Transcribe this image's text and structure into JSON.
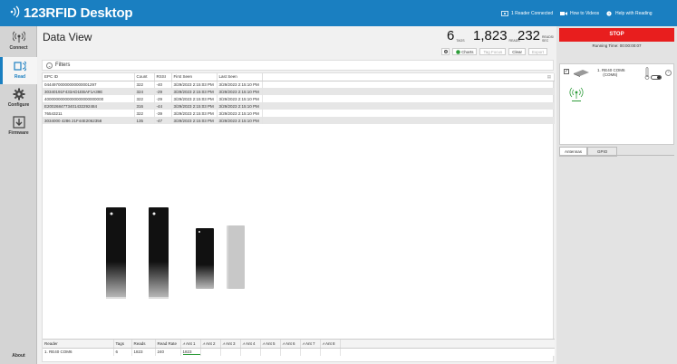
{
  "app": {
    "title": "123RFID Desktop",
    "header_items": {
      "reader_connected": "1 Reader Connected",
      "how_to_videos": "How to Videos",
      "help": "Help with Reading"
    }
  },
  "nav": {
    "items": [
      {
        "label": "Connect",
        "icon": "antenna-icon"
      },
      {
        "label": "Read",
        "icon": "rfid-read-icon",
        "active": true
      },
      {
        "label": "Configure",
        "icon": "gear-icon"
      },
      {
        "label": "Firmware",
        "icon": "download-icon"
      }
    ],
    "about": "About"
  },
  "main": {
    "title": "Data View",
    "stats": {
      "tags_value": "6",
      "tags_label": "TAGS",
      "reads_value": "1,823",
      "reads_label": "READS",
      "rate_value": "232",
      "rate_label_1": "READS/",
      "rate_label_2": "SEC"
    },
    "toolbar": {
      "charts": "Charts",
      "tag_focus": "Tag Focus",
      "clear": "Clear",
      "export": "Export"
    },
    "filters_label": "Filters",
    "columns": [
      "EPC ID",
      "Count",
      "RSSI",
      "First Seen",
      "Last Seen"
    ],
    "rows": [
      [
        "04449700000000000001297",
        "322",
        "-40",
        "3/29/2023 2:15:03 PM",
        "3/29/2023 2:15:10 PM"
      ],
      [
        "30340191F433AD1EBAF1A39E",
        "324",
        "-29",
        "3/29/2023 2:15:03 PM",
        "3/29/2023 2:15:10 PM"
      ],
      [
        "40000000000000000000000000",
        "322",
        "-29",
        "3/29/2023 2:15:03 PM",
        "3/29/2023 2:15:10 PM"
      ],
      [
        "E2002684773401432292484",
        "316",
        "-44",
        "3/29/2023 2:15:03 PM",
        "3/29/2023 2:15:10 PM"
      ],
      [
        "76543211",
        "322",
        "-39",
        "3/29/2023 2:15:03 PM",
        "3/29/2023 2:15:10 PM"
      ],
      [
        "3034000 4286 21F44E2062358",
        "135",
        "-47",
        "3/29/2023 2:15:03 PM",
        "3/29/2023 2:15:10 PM"
      ]
    ],
    "reader_table": {
      "columns": [
        "Reader",
        "Tags",
        "Reads",
        "Read Rate",
        "Ant 1",
        "Ant 2",
        "Ant 3",
        "Ant 4",
        "Ant 5",
        "Ant 6",
        "Ant 7",
        "Ant 8"
      ],
      "row": [
        "1. RE40 COM6",
        "6",
        "1823",
        "240",
        "1823",
        "",
        "",
        "",
        "",
        "",
        "",
        ""
      ]
    }
  },
  "right": {
    "stop": "STOP",
    "running_time": "Running Time: 00:00:00:07",
    "reader_name": "1. RE40 COM6",
    "reader_port": "(COM6)",
    "tabs": [
      "Antennas",
      "GPIO"
    ]
  },
  "colors": {
    "brand": "#1a7fc1",
    "stop": "#e81e1e",
    "antenna_bar": "#2e9c3a"
  }
}
